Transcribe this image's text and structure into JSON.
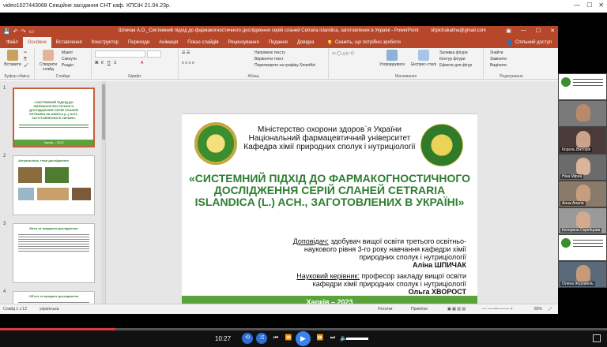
{
  "player": {
    "title": "video1027443068 Секційне засідання СНТ каф. ХПСіН 21.04.23р.",
    "time": "10:27",
    "controls": [
      "⏮",
      "⏪",
      "⏯",
      "⏩",
      "⏭"
    ],
    "progress_fraction": 0.19
  },
  "ppt": {
    "doc_title": "Шпичак А.О._Системний підхід до фармакогностичного дослідження серій сланей Cetraria islandica, заготовлених в Україні - PowerPoint",
    "user_email": "shpichakalina@gmail.com",
    "tabs": [
      "Файл",
      "Основне",
      "Вставлення",
      "Конструктор",
      "Переходи",
      "Анімація",
      "Показ слайдів",
      "Рецензування",
      "Подання",
      "Довідка"
    ],
    "tell_me": "Скажіть, що потрібно зробити",
    "share": "Спільний доступ",
    "ribbon": {
      "paste": "Вставити",
      "create_slide": "Створити слайд",
      "layout": "Макет",
      "reset": "Скинути",
      "section": "Розділ",
      "text_direction": "Напрямок тексту",
      "align_text": "Вирівняти текст",
      "convert_smartart": "Перетворити на графіку SmartArt",
      "arrange": "Упорядкувати",
      "quick_styles": "Експрес-стилі",
      "shape_fill": "Заливка фігури",
      "shape_outline": "Контур фігури",
      "shape_effects": "Ефекти для фігур",
      "find": "Знайти",
      "replace": "Замінити",
      "select": "Виділити",
      "groups": {
        "clipboard": "Буфер обміну",
        "slides": "Слайди",
        "font": "Шрифт",
        "paragraph": "Абзац",
        "drawing": "Малювання",
        "editing": "Редагування"
      }
    },
    "thumbs": [
      {
        "num": "1",
        "title": "«СИСТЕМНИЙ ПІДХІД ДО ФАРМАКОГНОСТИЧНОГО ДОСЛІДЖЕННЯ СЕРІЙ СЛАНЕЙ CETRARIA ISLANDICA (L.) ACH., ЗАГОТОВЛЕНИХ В УКРАЇНІ»",
        "footer": "Харків – 2023"
      },
      {
        "num": "2",
        "title": "Актуальність теми дослідження"
      },
      {
        "num": "3",
        "title": "Мета та завдання дослідження"
      },
      {
        "num": "4",
        "title": "Об'єкт та предмет дослідження"
      }
    ],
    "status": {
      "slide": "Слайд 1 з 13",
      "language": "українська",
      "notes": "Нотатки",
      "comments": "Примітки",
      "zoom": "85%"
    }
  },
  "slide": {
    "ministry": "Міністерство охорони здоров`я України",
    "university": "Національний фармацевтичний університет",
    "department": "Кафедра хімії природних сполук і нутриціології",
    "title": "«СИСТЕМНИЙ ПІДХІД ДО ФАРМАКОГНОСТИЧНОГО ДОСЛІДЖЕННЯ СЕРІЙ СЛАНЕЙ CETRARIA ISLANDICA (L.) ACH., ЗАГОТОВЛЕНИХ В УКРАЇНІ»",
    "reporter_label": "Доповідач:",
    "reporter_text": " здобувач вищої освіти третього освітньо-наукового рівня 3-го року навчання кафедри хімії природних сполук і нутриціології",
    "reporter_name": "Аліна ШПИЧАК",
    "supervisor_label": "Науковий керівник:",
    "supervisor_text": " професор закладу вищої освіти кафедри хімії природних сполук і нутриціології",
    "supervisor_name": "Ольга ХВОРОСТ",
    "footer": "Харків – 2023"
  },
  "participants": [
    {
      "name": "",
      "type": "logo"
    },
    {
      "name": "",
      "type": "face",
      "color": "#b88a6a"
    },
    {
      "name": "Король Вікторія",
      "type": "face",
      "color": "#caa38a"
    },
    {
      "name": "Ніна Мірна",
      "type": "face",
      "color": "#d7b49a"
    },
    {
      "name": "Анна Апала",
      "type": "face",
      "color": "#c79d80"
    },
    {
      "name": "Катерина Скребцова",
      "type": "face",
      "color": "#d2ab8f"
    },
    {
      "name": "",
      "type": "logo"
    },
    {
      "name": "Олена Журавель",
      "type": "face",
      "color": "#c69a7b"
    }
  ]
}
